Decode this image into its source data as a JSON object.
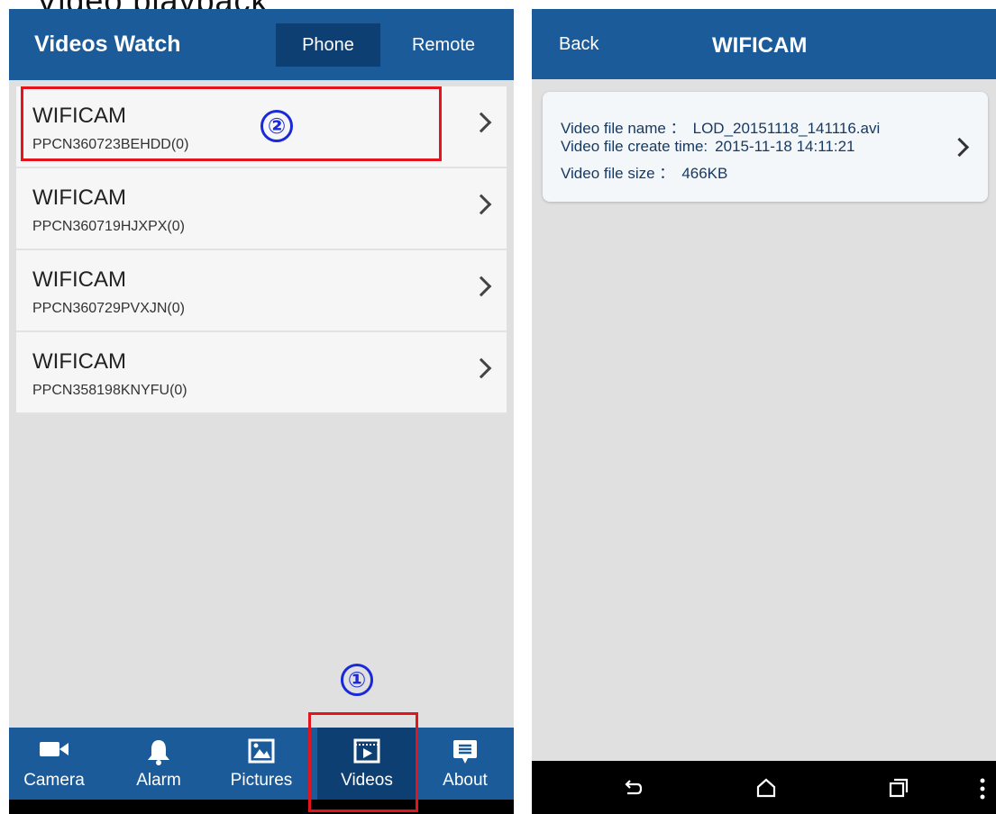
{
  "top_text": "Video playback",
  "left": {
    "header": {
      "title": "Videos Watch",
      "tab_phone": "Phone",
      "tab_remote": "Remote"
    },
    "devices": [
      {
        "name": "WIFICAM",
        "serial": "PPCN360723BEHDD(0)"
      },
      {
        "name": "WIFICAM",
        "serial": "PPCN360719HJXPX(0)"
      },
      {
        "name": "WIFICAM",
        "serial": "PPCN360729PVXJN(0)"
      },
      {
        "name": "WIFICAM",
        "serial": "PPCN358198KNYFU(0)"
      }
    ],
    "tabs": [
      {
        "label": "Camera",
        "icon": "video-camera-icon"
      },
      {
        "label": "Alarm",
        "icon": "bell-icon"
      },
      {
        "label": "Pictures",
        "icon": "picture-icon"
      },
      {
        "label": "Videos",
        "icon": "film-icon",
        "active": true
      },
      {
        "label": "About",
        "icon": "message-icon"
      }
    ]
  },
  "annotations": {
    "step1": "①",
    "step2": "②"
  },
  "right": {
    "header": {
      "back": "Back",
      "title": "WIFICAM"
    },
    "video": {
      "name_label": "Video file name ：",
      "name_value": "LOD_20151118_141116.avi",
      "time_label": "Video file create time:",
      "time_value": "2015-11-18  14:11:21",
      "size_label": "Video file size ：",
      "size_value": "466KB"
    }
  },
  "colors": {
    "header": "#1c5b99",
    "active_tab": "#0d3f73",
    "annotation_red": "#e3141c",
    "annotation_blue": "#1a2ad8"
  }
}
